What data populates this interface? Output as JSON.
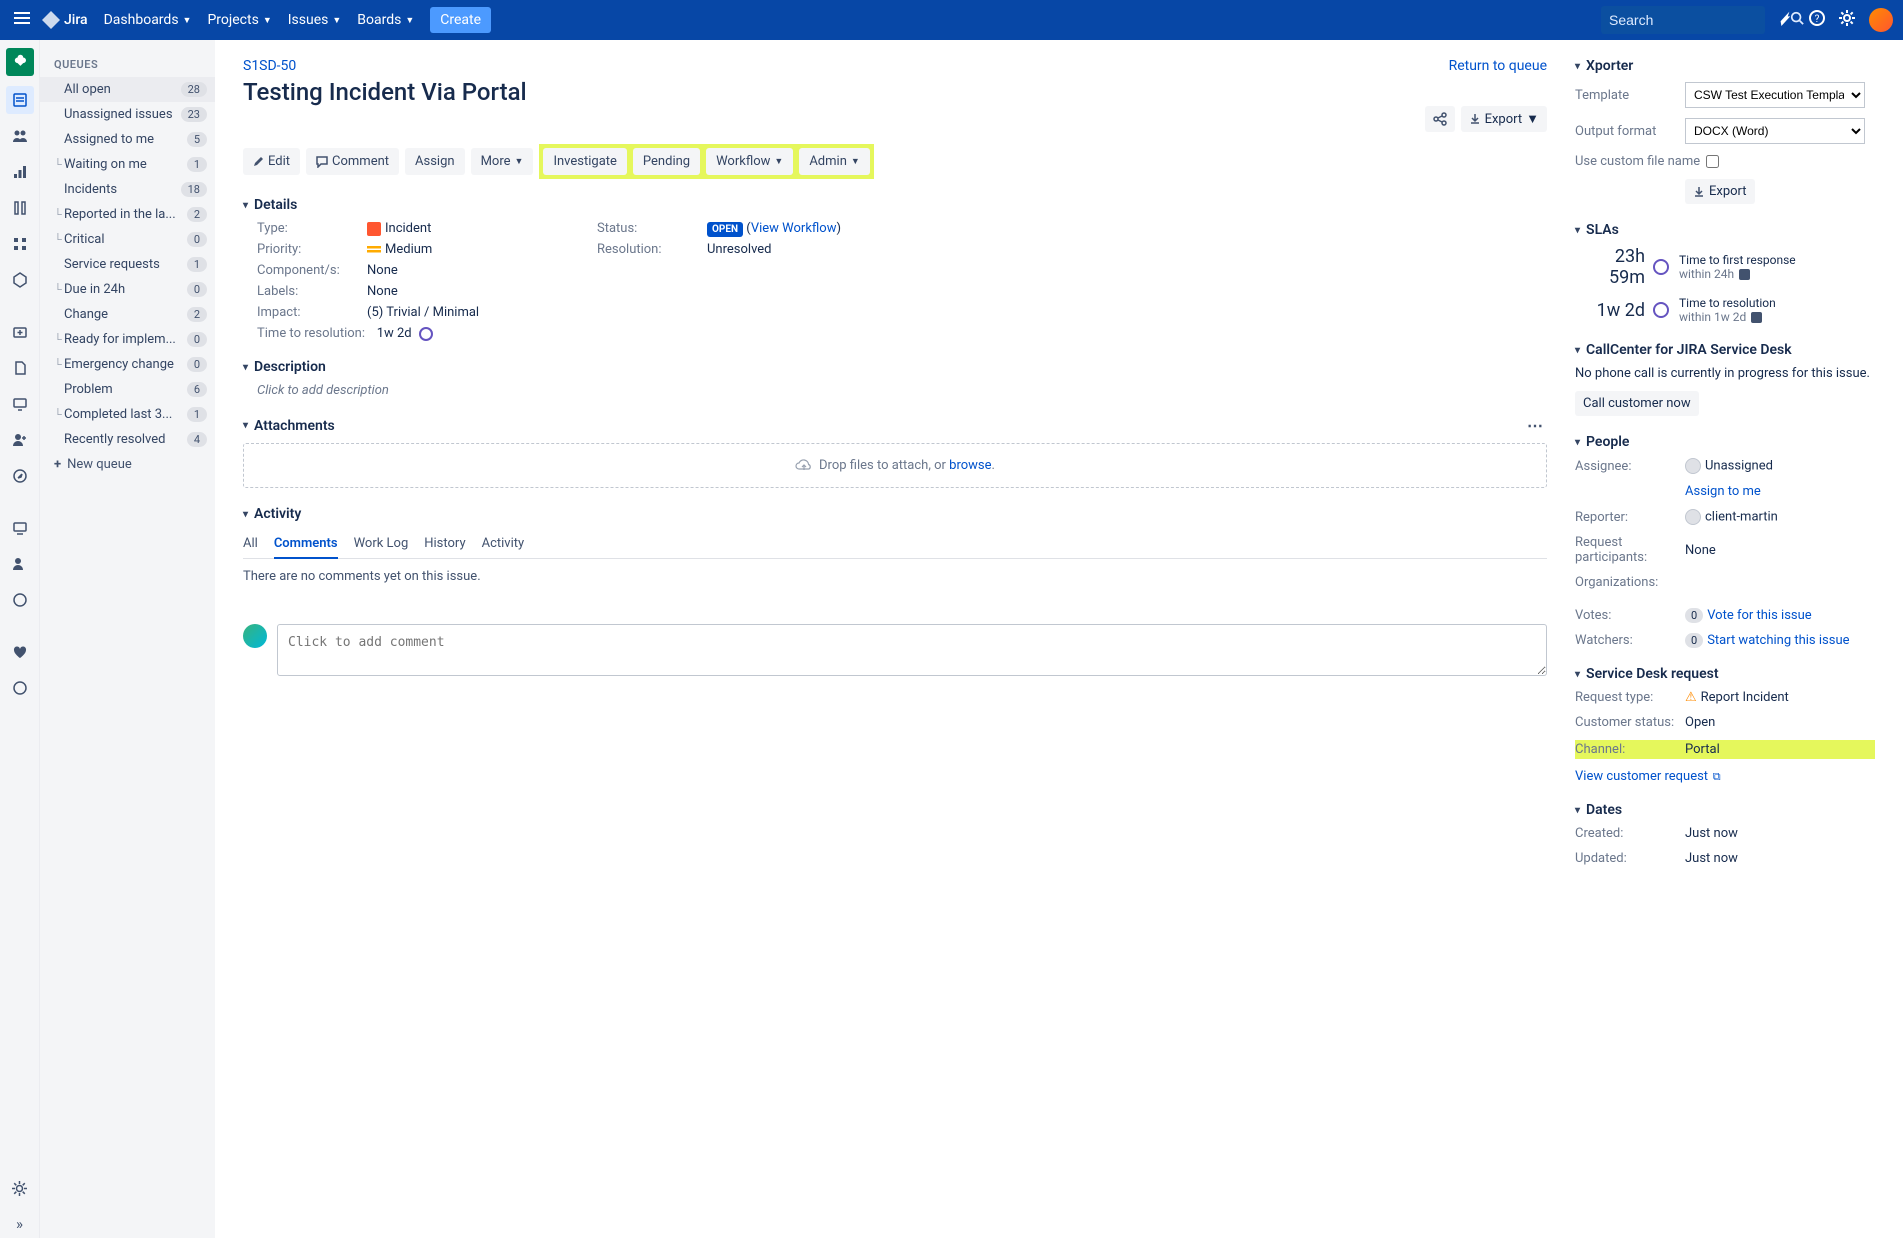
{
  "topnav": {
    "logo": "Jira",
    "items": [
      "Dashboards",
      "Projects",
      "Issues",
      "Boards"
    ],
    "create": "Create",
    "search_placeholder": "Search"
  },
  "sidebar": {
    "heading": "QUEUES",
    "new_queue": "New queue",
    "items": [
      {
        "label": "All open",
        "count": "28",
        "indent": false,
        "active": true
      },
      {
        "label": "Unassigned issues",
        "count": "23",
        "indent": false
      },
      {
        "label": "Assigned to me",
        "count": "5",
        "indent": false
      },
      {
        "label": "Waiting on me",
        "count": "1",
        "indent": true
      },
      {
        "label": "Incidents",
        "count": "18",
        "indent": false
      },
      {
        "label": "Reported in the la...",
        "count": "2",
        "indent": true
      },
      {
        "label": "Critical",
        "count": "0",
        "indent": true
      },
      {
        "label": "Service requests",
        "count": "1",
        "indent": false
      },
      {
        "label": "Due in 24h",
        "count": "0",
        "indent": true
      },
      {
        "label": "Change",
        "count": "2",
        "indent": false
      },
      {
        "label": "Ready for implem...",
        "count": "0",
        "indent": true
      },
      {
        "label": "Emergency change",
        "count": "0",
        "indent": true
      },
      {
        "label": "Problem",
        "count": "6",
        "indent": false
      },
      {
        "label": "Completed last 3...",
        "count": "1",
        "indent": true
      },
      {
        "label": "Recently resolved",
        "count": "4",
        "indent": false
      }
    ]
  },
  "issue": {
    "key": "S1SD-50",
    "title": "Testing Incident Via Portal",
    "return_link": "Return to queue",
    "actions": {
      "edit": "Edit",
      "comment": "Comment",
      "assign": "Assign",
      "more": "More",
      "investigate": "Investigate",
      "pending": "Pending",
      "workflow": "Workflow",
      "admin": "Admin",
      "export": "Export"
    },
    "sections": {
      "details": "Details",
      "description": "Description",
      "attachments": "Attachments",
      "activity": "Activity"
    },
    "details": {
      "type_l": "Type:",
      "type_v": "Incident",
      "priority_l": "Priority:",
      "priority_v": "Medium",
      "components_l": "Component/s:",
      "components_v": "None",
      "labels_l": "Labels:",
      "labels_v": "None",
      "impact_l": "Impact:",
      "impact_v": "(5) Trivial / Minimal",
      "ttr_l": "Time to resolution:",
      "ttr_v": "1w 2d",
      "status_l": "Status:",
      "status_v": "OPEN",
      "view_wf": "View Workflow",
      "resolution_l": "Resolution:",
      "resolution_v": "Unresolved"
    },
    "description": {
      "placeholder": "Click to add description"
    },
    "attachments": {
      "drop_text": "Drop files to attach, or ",
      "browse": "browse"
    },
    "activity": {
      "tabs": [
        "All",
        "Comments",
        "Work Log",
        "History",
        "Activity"
      ],
      "active": 1,
      "empty": "There are no comments yet on this issue.",
      "comment_ph": "Click to add comment"
    }
  },
  "right": {
    "xporter": {
      "title": "Xporter",
      "template_l": "Template",
      "template_v": "CSW Test Execution Template Docx",
      "format_l": "Output format",
      "format_v": "DOCX (Word)",
      "custom_l": "Use custom file name",
      "export_btn": "Export"
    },
    "slas": {
      "title": "SLAs",
      "items": [
        {
          "time": "23h 59m",
          "l1": "Time to first response",
          "l2": "within 24h"
        },
        {
          "time": "1w 2d",
          "l1": "Time to resolution",
          "l2": "within 1w 2d"
        }
      ]
    },
    "callcenter": {
      "title": "CallCenter for JIRA Service Desk",
      "msg": "No phone call is currently in progress for this issue.",
      "btn": "Call customer now"
    },
    "people": {
      "title": "People",
      "assignee_l": "Assignee:",
      "assignee_v": "Unassigned",
      "assign_me": "Assign to me",
      "reporter_l": "Reporter:",
      "reporter_v": "client-martin",
      "participants_l": "Request participants:",
      "participants_v": "None",
      "orgs_l": "Organizations:",
      "votes_l": "Votes:",
      "votes_c": "0",
      "votes_link": "Vote for this issue",
      "watchers_l": "Watchers:",
      "watchers_c": "0",
      "watchers_link": "Start watching this issue"
    },
    "sdrequest": {
      "title": "Service Desk request",
      "type_l": "Request type:",
      "type_v": "Report Incident",
      "cstatus_l": "Customer status:",
      "cstatus_v": "Open",
      "channel_l": "Channel:",
      "channel_v": "Portal",
      "view_link": "View customer request"
    },
    "dates": {
      "title": "Dates",
      "created_l": "Created:",
      "created_v": "Just now",
      "updated_l": "Updated:",
      "updated_v": "Just now"
    }
  }
}
